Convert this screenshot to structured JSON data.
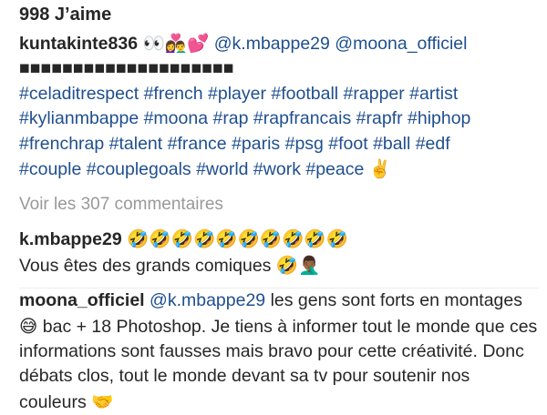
{
  "post": {
    "likes": "998 J’aime",
    "caption": {
      "username": "kuntakinte836",
      "emojis": "👀👩‍❤️‍👨💕",
      "mentions": [
        "@k.mbappe29",
        "@moona_officiel"
      ],
      "censor_bar": "■■■■■■■■■■■■■■■■■■■■",
      "hashtag_lines": [
        "#celaditrespect #french #player #football #rapper #artist",
        "#kylianmbappe #moona #rap #rapfrancais #rapfr #hiphop",
        "#frenchrap #talent #france #paris #psg #foot #ball #edf",
        "#couple #couplegoals #world #work #peace"
      ],
      "trailing_emoji": "✌️"
    },
    "view_comments": "Voir les 307 commentaires"
  },
  "comments": [
    {
      "username": "k.mbappe29",
      "emojis_inline": "🤣🤣🤣🤣🤣🤣🤣🤣🤣🤣",
      "text": "Vous êtes des grands comiques",
      "trailing_emojis": "🤣🤦🏾‍♂️"
    },
    {
      "username": "moona_officiel",
      "mention": "@k.mbappe29",
      "text_part1": "les gens sont forts en montages",
      "emoji_mid": "😅",
      "text_part2": "bac + 18 Photoshop. Je tiens à informer tout le monde que ces informations sont fausses mais bravo pour cette créativité. Donc débats clos, tout le monde devant sa tv pour soutenir nos couleurs",
      "trailing_emoji": "🤝"
    }
  ]
}
